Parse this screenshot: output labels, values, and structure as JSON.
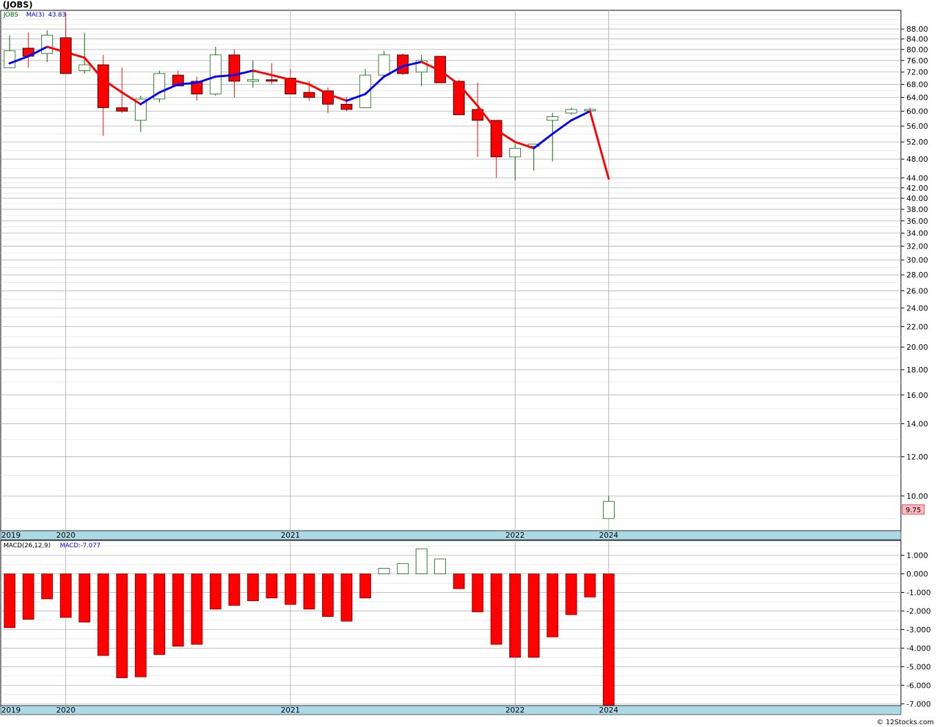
{
  "header": {
    "symbol": "(JOBS)"
  },
  "footer": {
    "copyright": "© 12Stocks.com"
  },
  "colors": {
    "up": "#006400",
    "down": "#ff0000",
    "ma_up": "#0000ff",
    "ma_down": "#ff0000",
    "axis_band": "#add8e6",
    "price_badge": "#ffb6c1"
  },
  "chart_data": [
    {
      "type": "candlestick",
      "legend": {
        "symbol": "JOBS",
        "ma_label": "MA(3)",
        "ma_value": "43.83"
      },
      "scale": "log",
      "ylim": [
        8.5,
        96
      ],
      "y_ticks": [
        "10.00",
        "12.00",
        "14.00",
        "16.00",
        "18.00",
        "20.00",
        "22.00",
        "24.00",
        "26.00",
        "28.00",
        "30.00",
        "32.00",
        "34.00",
        "36.00",
        "38.00",
        "40.00",
        "42.00",
        "44.00",
        "48.00",
        "52.00",
        "56.00",
        "60.00",
        "64.00",
        "68.00",
        "72.00",
        "76.00",
        "80.00",
        "84.00",
        "88.00"
      ],
      "x_labels": [
        "2019",
        "2020",
        "2021",
        "2022",
        "2024"
      ],
      "last_price": "9.75",
      "candles": [
        {
          "o": 73.5,
          "h": 85.5,
          "l": 73.5,
          "c": 79.5
        },
        {
          "o": 80.5,
          "h": 86.5,
          "l": 73.5,
          "c": 77.5
        },
        {
          "o": 78.5,
          "h": 87.5,
          "l": 75.5,
          "c": 85.5
        },
        {
          "o": 84.5,
          "h": 95.0,
          "l": 71.5,
          "c": 71.5
        },
        {
          "o": 72.5,
          "h": 86.5,
          "l": 71.5,
          "c": 74.5
        },
        {
          "o": 74.5,
          "h": 78.0,
          "l": 53.5,
          "c": 61.0
        },
        {
          "o": 61.0,
          "h": 73.5,
          "l": 59.5,
          "c": 60.0
        },
        {
          "o": 57.5,
          "h": 64.5,
          "l": 54.5,
          "c": 63.5
        },
        {
          "o": 63.5,
          "h": 72.5,
          "l": 62.5,
          "c": 71.5
        },
        {
          "o": 71.0,
          "h": 72.5,
          "l": 67.5,
          "c": 67.5
        },
        {
          "o": 69.0,
          "h": 70.5,
          "l": 63.0,
          "c": 65.0
        },
        {
          "o": 65.0,
          "h": 81.0,
          "l": 64.5,
          "c": 78.0
        },
        {
          "o": 78.0,
          "h": 80.0,
          "l": 64.0,
          "c": 69.0
        },
        {
          "o": 69.0,
          "h": 76.0,
          "l": 67.0,
          "c": 69.5
        },
        {
          "o": 69.5,
          "h": 75.0,
          "l": 68.0,
          "c": 69.0
        },
        {
          "o": 70.0,
          "h": 73.0,
          "l": 65.0,
          "c": 65.0
        },
        {
          "o": 65.5,
          "h": 69.0,
          "l": 63.0,
          "c": 64.0
        },
        {
          "o": 66.0,
          "h": 67.0,
          "l": 59.5,
          "c": 62.0
        },
        {
          "o": 62.0,
          "h": 64.0,
          "l": 60.0,
          "c": 60.5
        },
        {
          "o": 61.0,
          "h": 73.0,
          "l": 61.0,
          "c": 71.0
        },
        {
          "o": 71.0,
          "h": 79.5,
          "l": 71.0,
          "c": 78.0
        },
        {
          "o": 78.0,
          "h": 78.5,
          "l": 71.0,
          "c": 71.5
        },
        {
          "o": 72.0,
          "h": 78.0,
          "l": 67.5,
          "c": 76.0
        },
        {
          "o": 77.5,
          "h": 77.5,
          "l": 68.5,
          "c": 68.5
        },
        {
          "o": 69.0,
          "h": 69.5,
          "l": 59.0,
          "c": 59.0
        },
        {
          "o": 60.5,
          "h": 68.5,
          "l": 48.5,
          "c": 57.5
        },
        {
          "o": 57.5,
          "h": 57.5,
          "l": 44.0,
          "c": 48.5
        },
        {
          "o": 48.5,
          "h": 51.5,
          "l": 43.5,
          "c": 50.5
        },
        {
          "o": 51.0,
          "h": 51.5,
          "l": 45.5,
          "c": 51.5
        },
        {
          "o": 57.5,
          "h": 59.5,
          "l": 47.5,
          "c": 58.5
        },
        {
          "o": 59.5,
          "h": 61.0,
          "l": 59.0,
          "c": 60.5
        },
        {
          "o": 60.5,
          "h": 61.0,
          "l": 60.0,
          "c": 60.5
        },
        {
          "o": 9.0,
          "h": 10.0,
          "l": 9.0,
          "c": 9.75
        }
      ],
      "ma": [
        75.0,
        77.5,
        81.0,
        79.0,
        77.0,
        69.5,
        65.5,
        62.0,
        65.5,
        68.0,
        68.5,
        70.5,
        71.0,
        72.5,
        71.0,
        69.5,
        68.0,
        65.0,
        63.0,
        65.0,
        70.5,
        74.0,
        75.5,
        72.5,
        68.0,
        61.5,
        55.0,
        52.0,
        50.5,
        54.0,
        57.5,
        60.0,
        43.83
      ]
    },
    {
      "type": "bar",
      "legend": {
        "name": "MACD(26,12,9)",
        "value_label": "MACD:-7.077"
      },
      "ylim": [
        -7.1,
        1.8
      ],
      "y_ticks": [
        "1.000",
        "0.000",
        "-1.000",
        "-2.000",
        "-3.000",
        "-4.000",
        "-5.000",
        "-6.000",
        "-7.000"
      ],
      "x_labels": [
        "2019",
        "2020",
        "2021",
        "2022",
        "2024"
      ],
      "values": [
        -2.9,
        -2.45,
        -1.35,
        -2.35,
        -2.6,
        -4.4,
        -5.6,
        -5.55,
        -4.35,
        -3.9,
        -3.8,
        -1.9,
        -1.7,
        -1.45,
        -1.3,
        -1.65,
        -1.9,
        -2.3,
        -2.55,
        -1.3,
        0.3,
        0.55,
        1.35,
        0.8,
        -0.8,
        -2.05,
        -3.8,
        -4.5,
        -4.5,
        -3.4,
        -2.2,
        -1.25,
        -7.077
      ]
    }
  ]
}
